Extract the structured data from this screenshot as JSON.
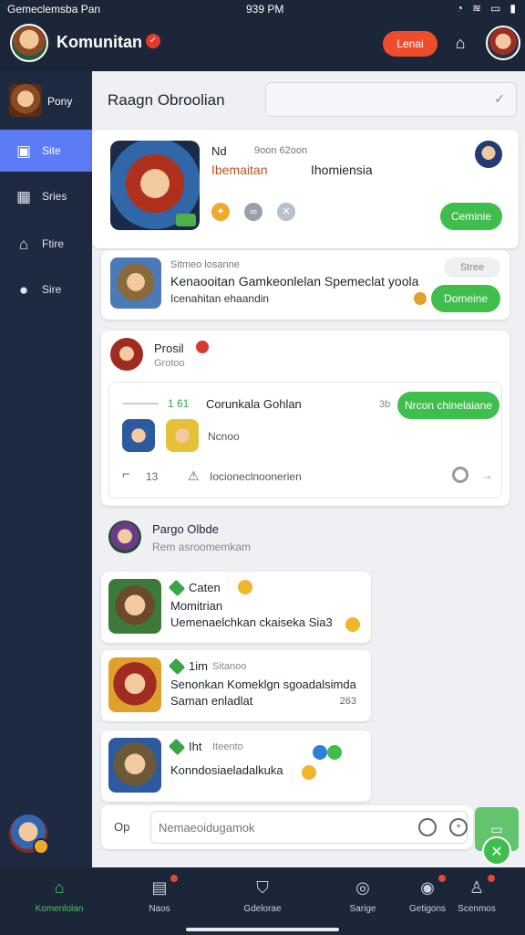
{
  "status": {
    "left": "Gemeclemsba Pan",
    "time": "939 PM"
  },
  "header": {
    "title": "Komunitan",
    "action_label": "Lenai"
  },
  "sidebar": {
    "profile_name": "Pony",
    "items": [
      {
        "label": "Site",
        "icon": "chat-icon"
      },
      {
        "label": "Sries",
        "icon": "box-icon"
      },
      {
        "label": "Ftire",
        "icon": "home-icon"
      },
      {
        "label": "Sire",
        "icon": "gamepad-icon"
      }
    ]
  },
  "main": {
    "title": "Raagn Obroolian",
    "select_value": "",
    "feature": {
      "name": "Nd",
      "meta": "9oon  62oon",
      "subtitle": "Ibemaitan",
      "subtitle2": "Ihomiensia",
      "button": "Ceminie"
    },
    "second": {
      "meta": "Sitmeo  losanne",
      "pill": "Stree",
      "title": "Kenaooitan Gamkeonlelan Spemeclat yoola",
      "subtitle": "Icenahitan ehaandin",
      "button": "Domeine"
    },
    "post": {
      "name": "Prosil",
      "sub": "Grotoo",
      "count": "1  61",
      "inner_title": "Corunkala Gohlan",
      "small": "3b",
      "button": "Nrcon chinelaiane",
      "member_name": "Ncnoo",
      "likes": "13",
      "comment": "Iocioneclnoonerien"
    },
    "section": {
      "title": "Pargo Olbde",
      "sub": "Rem asroomemkam"
    },
    "messages": [
      {
        "name": "Caten",
        "meta": "",
        "line1": "Momitrian",
        "line2": "Uemenaelchkan ckaiseka Sia3",
        "extra": ""
      },
      {
        "name": "1im",
        "meta": "Sitanoo",
        "line1": "Senonkan Komeklgn sgoadalsimda",
        "line2": "Saman enladlat",
        "extra": "263"
      },
      {
        "name": "Iht",
        "meta": "Iteento",
        "line1": "Konndosiaeladalkuka",
        "line2": "",
        "extra": ""
      }
    ],
    "composer": {
      "label": "Op",
      "placeholder": "Nemaeoidugamok"
    }
  },
  "bottom_nav": [
    {
      "label": "Komenlolan",
      "icon": "home-icon"
    },
    {
      "label": "Naos",
      "icon": "news-icon"
    },
    {
      "label": "Gdelorae",
      "icon": "shield-icon"
    },
    {
      "label": "Sarige",
      "icon": "compass-icon"
    },
    {
      "label": "Getigons",
      "icon": "record-icon"
    },
    {
      "label": "Scenmos",
      "icon": "user-icon"
    }
  ],
  "colors": {
    "accent_green": "#3fbe4d",
    "accent_orange": "#ee4d2d",
    "sidebar_active": "#5b7cf5",
    "navy": "#1b2638"
  }
}
